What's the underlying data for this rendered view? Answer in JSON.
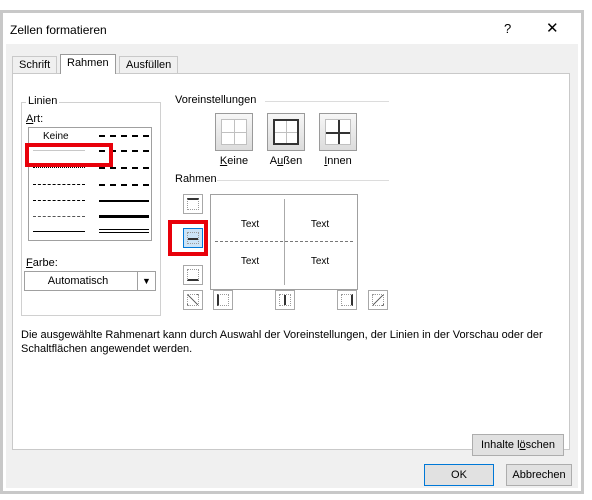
{
  "dialog": {
    "title": "Zellen formatieren",
    "help_label": "?",
    "close_label": "✕"
  },
  "tabs": [
    {
      "label": "Schrift"
    },
    {
      "label": "Rahmen"
    },
    {
      "label": "Ausfüllen"
    }
  ],
  "linien": {
    "group_label": "Linien",
    "art_label_u": "A",
    "art_label_rest": "rt:",
    "none_label": "Keine",
    "farbe_label_u": "F",
    "farbe_label_rest": "arbe:",
    "farbe_value": "Automatisch"
  },
  "voreinstellungen": {
    "group_label": "Voreinstellungen",
    "presets": [
      {
        "label_u": "K",
        "label_rest": "eine"
      },
      {
        "label_pre": "A",
        "label_u": "u",
        "label_rest": "ßen"
      },
      {
        "label_u": "I",
        "label_rest": "nnen"
      }
    ]
  },
  "rahmen": {
    "group_label": "Rahmen",
    "preview_cells": [
      "Text",
      "Text",
      "Text",
      "Text"
    ]
  },
  "description": "Die ausgewählte Rahmenart kann durch Auswahl der Voreinstellungen, der Linien in der Vorschau oder der Schaltflächen angewendet werden.",
  "buttons": {
    "clear_pre": "Inhalte l",
    "clear_u": "ö",
    "clear_rest": "schen",
    "ok": "OK",
    "cancel": "Abbrechen"
  },
  "colors": {
    "highlight": "#e8000a",
    "accent": "#0078d7"
  }
}
